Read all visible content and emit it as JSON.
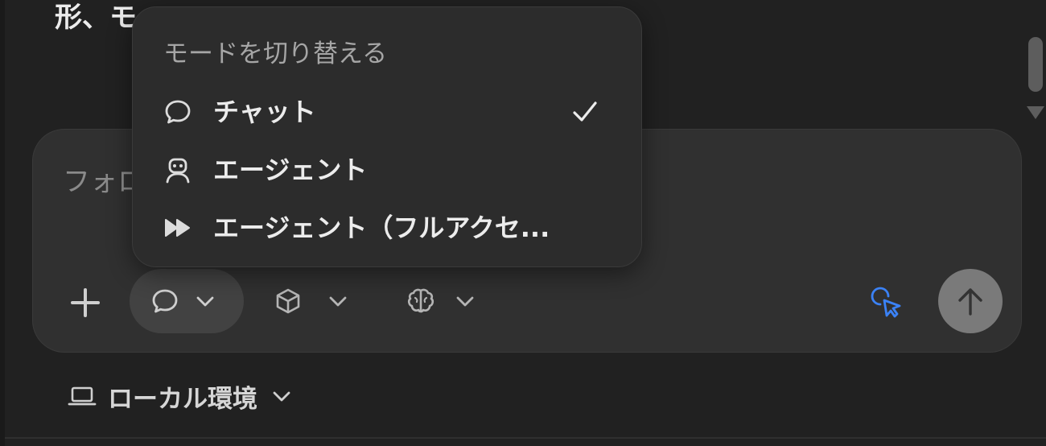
{
  "background_message": {
    "text": "形、モ…"
  },
  "composer": {
    "placeholder": "フォロ"
  },
  "mode_menu": {
    "title": "モードを切り替える",
    "items": [
      {
        "label": "チャット",
        "icon": "chat-bubble-icon",
        "selected": true
      },
      {
        "label": "エージェント",
        "icon": "robot-icon",
        "selected": false
      },
      {
        "label": "エージェント（フルアクセ...",
        "icon": "fast-forward-icon",
        "selected": false
      }
    ]
  },
  "environment": {
    "label": "ローカル環境",
    "icon": "laptop-icon"
  },
  "colors": {
    "background": "#212121",
    "composer": "#303030",
    "menu": "#2c2c2c",
    "accent_cursor": "#3b82f6",
    "send_button": "#7a7a7a"
  }
}
